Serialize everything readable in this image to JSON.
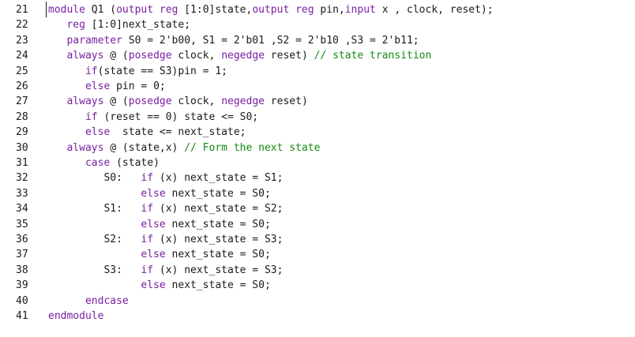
{
  "editor": {
    "lines": [
      {
        "num": "21",
        "tokens": [
          {
            "t": "kw",
            "v": "module"
          },
          {
            "t": "tx",
            "v": " Q1 ("
          },
          {
            "t": "kw",
            "v": "output"
          },
          {
            "t": "tx",
            "v": " "
          },
          {
            "t": "kw",
            "v": "reg"
          },
          {
            "t": "tx",
            "v": " [1:0]state,"
          },
          {
            "t": "kw",
            "v": "output"
          },
          {
            "t": "tx",
            "v": " "
          },
          {
            "t": "kw",
            "v": "reg"
          },
          {
            "t": "tx",
            "v": " pin,"
          },
          {
            "t": "kw",
            "v": "input"
          },
          {
            "t": "tx",
            "v": " x , clock, reset);"
          }
        ]
      },
      {
        "num": "22",
        "tokens": [
          {
            "t": "tx",
            "v": "   "
          },
          {
            "t": "kw",
            "v": "reg"
          },
          {
            "t": "tx",
            "v": " [1:0]next_state;"
          }
        ]
      },
      {
        "num": "23",
        "tokens": [
          {
            "t": "tx",
            "v": "   "
          },
          {
            "t": "kw",
            "v": "parameter"
          },
          {
            "t": "tx",
            "v": " S0 = 2'b00, S1 = 2'b01 ,S2 = 2'b10 ,S3 = 2'b11;"
          }
        ]
      },
      {
        "num": "24",
        "tokens": [
          {
            "t": "tx",
            "v": "   "
          },
          {
            "t": "kw",
            "v": "always"
          },
          {
            "t": "tx",
            "v": " @ ("
          },
          {
            "t": "kw",
            "v": "posedge"
          },
          {
            "t": "tx",
            "v": " clock, "
          },
          {
            "t": "kw",
            "v": "negedge"
          },
          {
            "t": "tx",
            "v": " reset) "
          },
          {
            "t": "cm",
            "v": "// state transition"
          }
        ]
      },
      {
        "num": "25",
        "tokens": [
          {
            "t": "tx",
            "v": "      "
          },
          {
            "t": "kw",
            "v": "if"
          },
          {
            "t": "tx",
            "v": "(state == S3)pin = 1;"
          }
        ]
      },
      {
        "num": "26",
        "tokens": [
          {
            "t": "tx",
            "v": "      "
          },
          {
            "t": "kw",
            "v": "else"
          },
          {
            "t": "tx",
            "v": " pin = 0;"
          }
        ]
      },
      {
        "num": "27",
        "tokens": [
          {
            "t": "tx",
            "v": "   "
          },
          {
            "t": "kw",
            "v": "always"
          },
          {
            "t": "tx",
            "v": " @ ("
          },
          {
            "t": "kw",
            "v": "posedge"
          },
          {
            "t": "tx",
            "v": " clock, "
          },
          {
            "t": "kw",
            "v": "negedge"
          },
          {
            "t": "tx",
            "v": " reset)"
          }
        ]
      },
      {
        "num": "28",
        "tokens": [
          {
            "t": "tx",
            "v": "      "
          },
          {
            "t": "kw",
            "v": "if"
          },
          {
            "t": "tx",
            "v": " (reset == 0) state <= S0;"
          }
        ]
      },
      {
        "num": "29",
        "tokens": [
          {
            "t": "tx",
            "v": "      "
          },
          {
            "t": "kw",
            "v": "else"
          },
          {
            "t": "tx",
            "v": "  state <= next_state;"
          }
        ]
      },
      {
        "num": "30",
        "tokens": [
          {
            "t": "tx",
            "v": "   "
          },
          {
            "t": "kw",
            "v": "always"
          },
          {
            "t": "tx",
            "v": " @ (state,x) "
          },
          {
            "t": "cm",
            "v": "// Form the next state"
          }
        ]
      },
      {
        "num": "31",
        "tokens": [
          {
            "t": "tx",
            "v": "      "
          },
          {
            "t": "kw",
            "v": "case"
          },
          {
            "t": "tx",
            "v": " (state)"
          }
        ]
      },
      {
        "num": "32",
        "tokens": [
          {
            "t": "tx",
            "v": "         S0:   "
          },
          {
            "t": "kw",
            "v": "if"
          },
          {
            "t": "tx",
            "v": " (x) next_state = S1;"
          }
        ]
      },
      {
        "num": "33",
        "tokens": [
          {
            "t": "tx",
            "v": "               "
          },
          {
            "t": "kw",
            "v": "else"
          },
          {
            "t": "tx",
            "v": " next_state = S0;"
          }
        ]
      },
      {
        "num": "34",
        "tokens": [
          {
            "t": "tx",
            "v": "         S1:   "
          },
          {
            "t": "kw",
            "v": "if"
          },
          {
            "t": "tx",
            "v": " (x) next_state = S2;"
          }
        ]
      },
      {
        "num": "35",
        "tokens": [
          {
            "t": "tx",
            "v": "               "
          },
          {
            "t": "kw",
            "v": "else"
          },
          {
            "t": "tx",
            "v": " next_state = S0;"
          }
        ]
      },
      {
        "num": "36",
        "tokens": [
          {
            "t": "tx",
            "v": "         S2:   "
          },
          {
            "t": "kw",
            "v": "if"
          },
          {
            "t": "tx",
            "v": " (x) next_state = S3;"
          }
        ]
      },
      {
        "num": "37",
        "tokens": [
          {
            "t": "tx",
            "v": "               "
          },
          {
            "t": "kw",
            "v": "else"
          },
          {
            "t": "tx",
            "v": " next_state = S0;"
          }
        ]
      },
      {
        "num": "38",
        "tokens": [
          {
            "t": "tx",
            "v": "         S3:   "
          },
          {
            "t": "kw",
            "v": "if"
          },
          {
            "t": "tx",
            "v": " (x) next_state = S3;"
          }
        ]
      },
      {
        "num": "39",
        "tokens": [
          {
            "t": "tx",
            "v": "               "
          },
          {
            "t": "kw",
            "v": "else"
          },
          {
            "t": "tx",
            "v": " next_state = S0;"
          }
        ]
      },
      {
        "num": "40",
        "tokens": [
          {
            "t": "tx",
            "v": "      "
          },
          {
            "t": "kw",
            "v": "endcase"
          }
        ]
      },
      {
        "num": "41",
        "tokens": [
          {
            "t": "kw",
            "v": "endmodule"
          }
        ]
      }
    ]
  },
  "colors": {
    "keyword": "#7a1fa2",
    "comment": "#148a14",
    "text": "#1a1a1a",
    "background": "#ffffff"
  }
}
